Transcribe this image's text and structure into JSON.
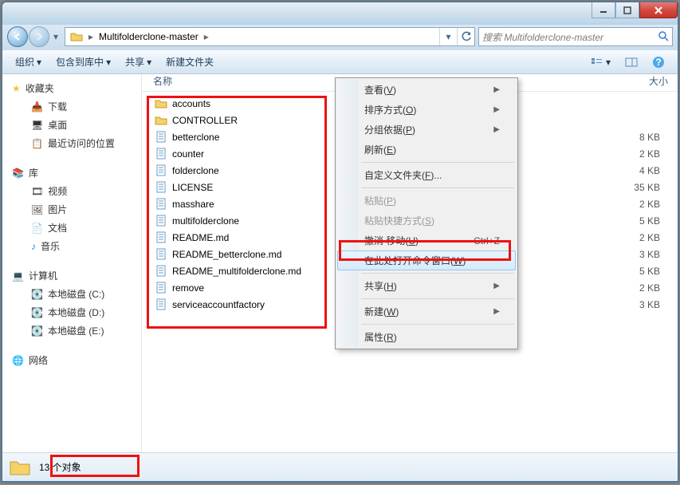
{
  "address": {
    "path_segment": "Multifolderclone-master",
    "search_placeholder": "搜索 Multifolderclone-master"
  },
  "toolbar": {
    "organize": "组织",
    "include": "包含到库中",
    "share": "共享",
    "newfolder": "新建文件夹"
  },
  "columns": {
    "name": "名称",
    "size": "大小"
  },
  "sidebar": {
    "favorites": "收藏夹",
    "downloads": "下载",
    "desktop": "桌面",
    "recent": "最近访问的位置",
    "libraries": "库",
    "video": "视频",
    "pictures": "图片",
    "documents": "文档",
    "music": "音乐",
    "computer": "计算机",
    "disk_c": "本地磁盘 (C:)",
    "disk_d": "本地磁盘 (D:)",
    "disk_e": "本地磁盘 (E:)",
    "network": "网络"
  },
  "files": [
    {
      "name": "accounts",
      "type": "folder",
      "size": ""
    },
    {
      "name": "CONTROLLER",
      "type": "folder",
      "size": ""
    },
    {
      "name": "betterclone",
      "type": "file",
      "size": "8 KB"
    },
    {
      "name": "counter",
      "type": "file",
      "size": "2 KB"
    },
    {
      "name": "folderclone",
      "type": "file",
      "size": "4 KB"
    },
    {
      "name": "LICENSE",
      "type": "file",
      "size": "35 KB"
    },
    {
      "name": "masshare",
      "type": "file",
      "size": "2 KB"
    },
    {
      "name": "multifolderclone",
      "type": "file",
      "size": "5 KB"
    },
    {
      "name": "README.md",
      "type": "file",
      "size": "2 KB"
    },
    {
      "name": "README_betterclone.md",
      "type": "file",
      "size": "3 KB"
    },
    {
      "name": "README_multifolderclone.md",
      "type": "file",
      "size": "5 KB"
    },
    {
      "name": "remove",
      "type": "file",
      "size": "2 KB"
    },
    {
      "name": "serviceaccountfactory",
      "type": "file",
      "size": "3 KB"
    }
  ],
  "context_menu": {
    "view": "查看",
    "view_k": "V",
    "sort": "排序方式",
    "sort_k": "O",
    "group": "分组依据",
    "group_k": "P",
    "refresh": "刷新",
    "refresh_k": "E",
    "customize": "自定义文件夹",
    "customize_k": "F",
    "paste": "粘贴",
    "paste_k": "P",
    "paste_shortcut": "粘贴快捷方式",
    "paste_shortcut_k": "S",
    "undo": "撤消 移动",
    "undo_k": "U",
    "undo_accel": "Ctrl+Z",
    "open_cmd": "在此处打开命令窗口",
    "open_cmd_k": "W",
    "share": "共享",
    "share_k": "H",
    "new": "新建",
    "new_k": "W",
    "properties": "属性",
    "properties_k": "R"
  },
  "status": {
    "text": "13 个对象"
  }
}
